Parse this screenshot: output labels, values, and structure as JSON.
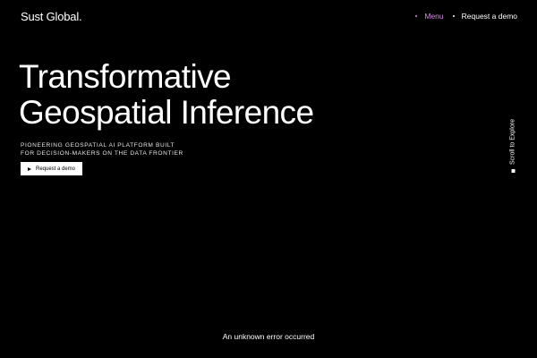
{
  "header": {
    "logo_text": "Sust Global.",
    "nav": {
      "menu_label": "Menu",
      "request_demo_label": "Request a demo"
    }
  },
  "hero": {
    "headline_line1": "Transformative",
    "headline_line2": "Geospatial Inference",
    "subheadline_line1": "PIONEERING GEOSPATIAL AI PLATFORM BUILT",
    "subheadline_line2": "FOR DECISION-MAKERS ON THE DATA FRONTIER",
    "cta_label": "Request a demo"
  },
  "scroll_indicator": {
    "label": "Scroll to Explore"
  },
  "error": {
    "message": "An unknown error occurred"
  },
  "colors": {
    "background": "#000000",
    "text": "#ffffff",
    "accent": "#d38ce6"
  },
  "icons": {
    "nav_dot": "dot-icon",
    "cta_icon": "play-icon",
    "scroll_icon": "square-icon"
  }
}
